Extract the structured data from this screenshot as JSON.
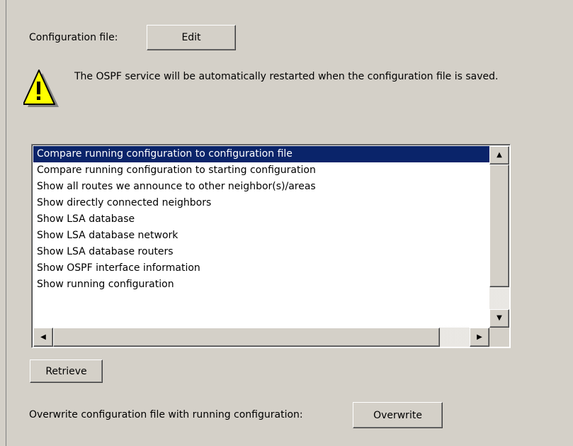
{
  "config": {
    "label": "Configuration file:",
    "edit_label": "Edit",
    "warning_text": "The OSPF service will be automatically restarted when the configuration file is saved."
  },
  "commands": {
    "items": [
      "Compare running configuration to configuration file",
      "Compare running configuration to starting configuration",
      "Show all routes we announce to other neighbor(s)/areas",
      "Show directly connected neighbors",
      "Show LSA database",
      "Show LSA database network",
      "Show LSA database routers",
      "Show OSPF interface information",
      "Show running configuration"
    ],
    "selected_index": 0,
    "retrieve_label": "Retrieve"
  },
  "overwrite": {
    "label": "Overwrite configuration file with running configuration:",
    "button_label": "Overwrite"
  },
  "icons": {
    "warning": "warning-icon",
    "scroll_up": "arrow-up-icon",
    "scroll_down": "arrow-down-icon",
    "scroll_left": "arrow-left-icon",
    "scroll_right": "arrow-right-icon"
  },
  "colors": {
    "selection": "#0a246a",
    "panel": "#d4d0c8",
    "warning_fill": "#ffff00"
  }
}
